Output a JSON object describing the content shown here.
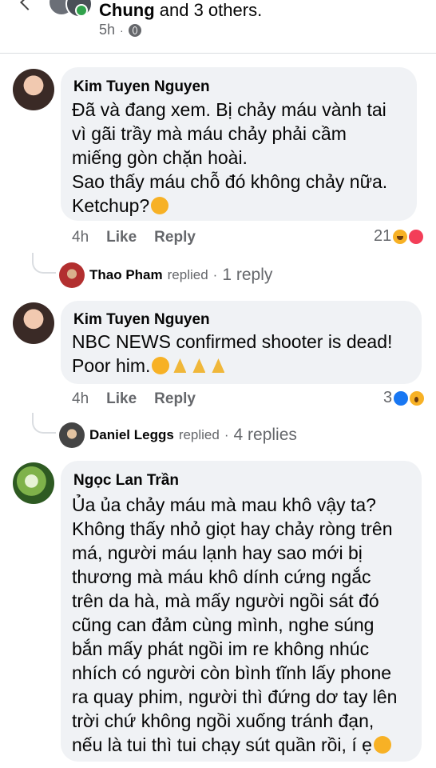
{
  "post_header": {
    "title_name": "Chung",
    "title_rest": " and 3 others.",
    "time": "5h"
  },
  "comments": [
    {
      "author": "Kim Tuyen Nguyen",
      "text": "Đã và đang xem. Bị chảy máu vành tai\nvì gãi trầy mà máu chảy phải cầm\nmiếng gòn chặn hoài.\nSao thấy máu chỗ đó không chảy nữa.\nKetchup?",
      "time": "4h",
      "like_label": "Like",
      "reply_label": "Reply",
      "reaction_count": "21",
      "replies": {
        "name": "Thao Pham",
        "replied_label": "replied",
        "sep": "·",
        "count_label": "1 reply"
      }
    },
    {
      "author": "Kim Tuyen Nguyen",
      "text": "NBC NEWS confirmed shooter is dead!\nPoor him.",
      "time": "4h",
      "like_label": "Like",
      "reply_label": "Reply",
      "reaction_count": "3",
      "replies": {
        "name": "Daniel Leggs",
        "replied_label": "replied",
        "sep": "·",
        "count_label": "4 replies"
      }
    },
    {
      "author": "Ngọc Lan Trần",
      "text": "Ủa ủa chảy máu mà mau khô vậy ta?\nKhông thấy nhỏ giọt hay chảy ròng trên\nmá, người máu lạnh hay sao mới bị\nthương mà máu khô dính cứng ngắc\ntrên da hà, mà mấy người ngồi sát đó\ncũng can đảm cùng mình, nghe súng\nbắn mấy phát ngồi im re không nhúc\nnhích có người còn bình tĩnh lấy phone\nra quay phim, người thì đứng dơ tay lên\ntrời chứ không ngồi xuống tránh đạn,\nnếu là tui thì tui chạy sút quần rồi, í ẹ"
    }
  ]
}
